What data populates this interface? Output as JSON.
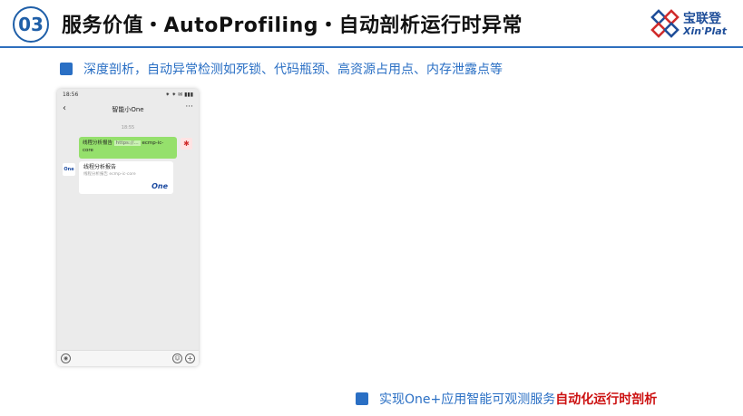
{
  "header": {
    "number": "03",
    "title": "服务价值・AutoProfiling・自动剖析运行时异常",
    "brand_cn": "宝联登",
    "brand_en": "Xin'Plat"
  },
  "bullet1": {
    "text": "深度剖析，自动异常检测如死锁、代码瓶颈、高资源占用点、内存泄露点等"
  },
  "phone": {
    "status_time": "18:56",
    "status_icons": "⁕ ⁕ ✉ ▮▮▮",
    "back_icon": "chevron-left-icon",
    "chat_title": "智能小One",
    "more_icon": "more-dots-icon",
    "chat_time": "18:55",
    "outgoing": {
      "text": "线程分析报告",
      "link": "https://...",
      "suffix": "ecmp-ic-core"
    },
    "incoming_avatar": "One",
    "card": {
      "title": "线程分析报告",
      "subtitle": "线程分析报告 ecmp-ic-core",
      "logo": "One"
    }
  },
  "bullet2": {
    "text": "实现One+应用智能可观测服务",
    "highlight": "自动化运行时剖析"
  },
  "colors": {
    "accent": "#2a6fc4",
    "highlight": "#cc1111",
    "bubble": "#95e06c"
  }
}
